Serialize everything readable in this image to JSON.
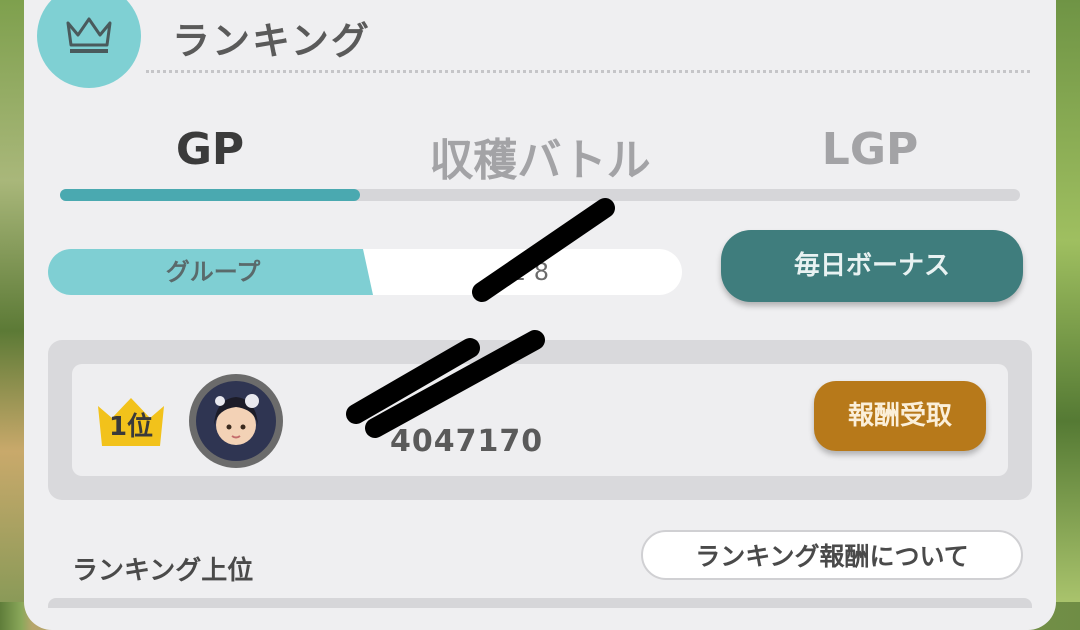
{
  "header": {
    "title": "ランキング",
    "icon": "crown-icon"
  },
  "tabs": [
    {
      "label": "GP",
      "active": true
    },
    {
      "label": "収穫バトル",
      "active": false
    },
    {
      "label": "LGP",
      "active": false
    }
  ],
  "segment": {
    "left_label": "グループ",
    "right_label": "2 8"
  },
  "daily_bonus_label": "毎日ボーナス",
  "rank_row": {
    "rank_label": "1位",
    "score": "4047170",
    "reward_label": "報酬受取"
  },
  "section": {
    "label": "ランキング上位",
    "about_label": "ランキング報酬について"
  },
  "colors": {
    "accent": "#4aa9b0",
    "crown_circle": "#7fd0d3",
    "bonus_button": "#3f7d7d",
    "reward_button": "#b7791a",
    "badge": "#f2c21b"
  }
}
